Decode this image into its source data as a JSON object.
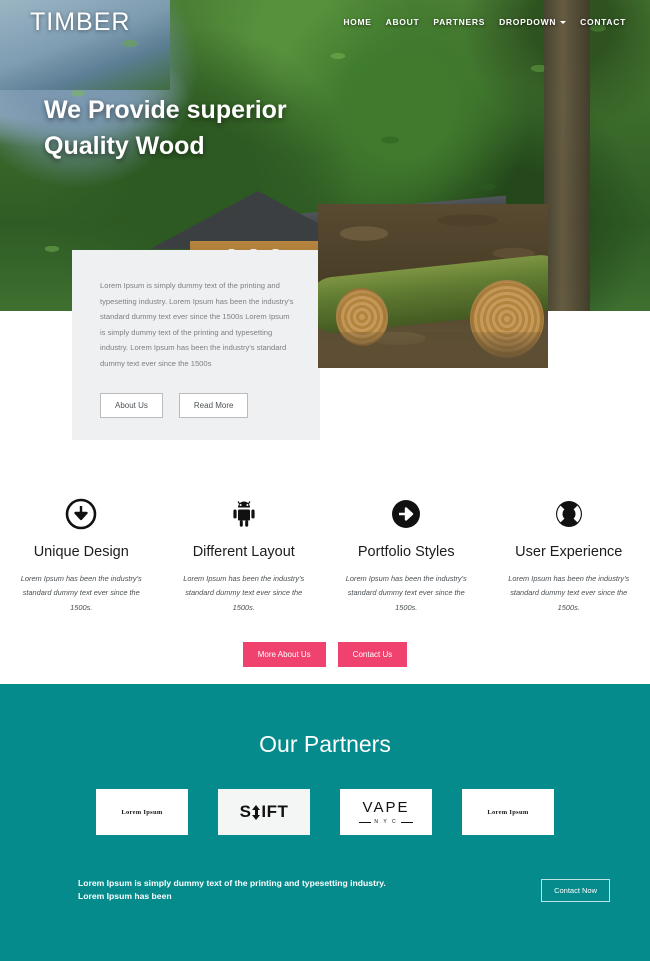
{
  "header": {
    "logo": "TIMBER",
    "nav": [
      {
        "label": "HOME",
        "dropdown": false
      },
      {
        "label": "ABOUT",
        "dropdown": false
      },
      {
        "label": "PARTNERS",
        "dropdown": false
      },
      {
        "label": "DROPDOWN",
        "dropdown": true
      },
      {
        "label": "CONTACT",
        "dropdown": false
      }
    ]
  },
  "hero": {
    "title_line1": "We Provide superior",
    "title_line2": "Quality Wood"
  },
  "intro_card": {
    "paragraph": "Lorem Ipsum is simply dummy text of the printing and typesetting industry. Lorem Ipsum has been the industry's standard dummy text ever since the 1500s Lorem Ipsum is simply dummy text of the printing and typesetting industry. Lorem Ipsum has been the industry's standard dummy text ever since the 1500s",
    "buttons": [
      {
        "label": "About Us"
      },
      {
        "label": "Read More"
      }
    ]
  },
  "features": [
    {
      "icon": "arrow-down-circle-icon",
      "title": "Unique Design",
      "description": "Lorem Ipsum has been the industry's standard dummy text ever since the 1500s."
    },
    {
      "icon": "android-icon",
      "title": "Different Layout",
      "description": "Lorem Ipsum has been the industry's standard dummy text ever since the 1500s."
    },
    {
      "icon": "arrow-right-circle-icon",
      "title": "Portfolio Styles",
      "description": "Lorem Ipsum has been the industry's standard dummy text ever since the 1500s."
    },
    {
      "icon": "lifebuoy-support-icon",
      "title": "User Experience",
      "description": "Lorem Ipsum has been the industry's standard dummy text ever since the 1500s."
    }
  ],
  "cta": {
    "buttons": [
      {
        "label": "More About Us"
      },
      {
        "label": "Contact Us"
      }
    ],
    "accent_color": "#f0426f"
  },
  "partners": {
    "title": "Our Partners",
    "background_color": "#058b8c",
    "logos": [
      {
        "name": "lorem-ipsum-logo",
        "text": "Lorem Ipsum"
      },
      {
        "name": "shift-logo",
        "text_left": "S",
        "text_right": "IFT"
      },
      {
        "name": "vape-nyc-logo",
        "text": "VAPE",
        "subtext": "N Y C"
      },
      {
        "name": "lorem-ipsum-logo-2",
        "text": "Lorem Ipsum"
      }
    ],
    "footer_line1": "Lorem Ipsum is simply dummy text of the printing and typesetting industry.",
    "footer_line2": "Lorem Ipsum has been",
    "footer_button": "Contact Now"
  }
}
